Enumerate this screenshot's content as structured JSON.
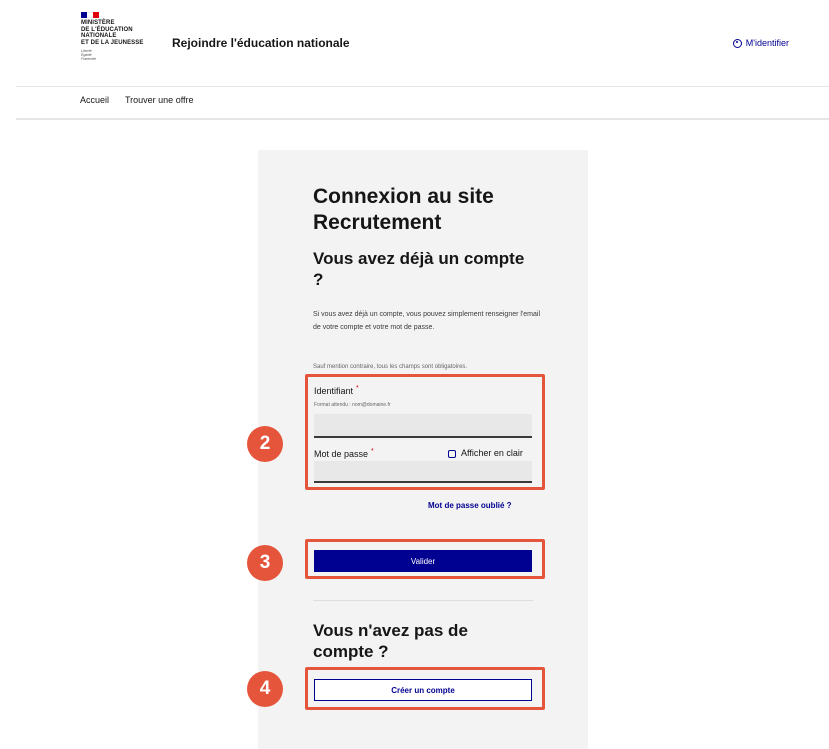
{
  "header": {
    "logo_lines": [
      "MINISTÈRE",
      "DE L'ÉDUCATION",
      "NATIONALE",
      "ET DE LA JEUNESSE"
    ],
    "devise": [
      "Liberté",
      "Égalité",
      "Fraternité"
    ],
    "flag_colors": [
      "#000091",
      "#ffffff",
      "#e1000f"
    ],
    "site_title": "Rejoindre l'éducation nationale",
    "login_link": "M'identifier",
    "login_icon": "user-icon"
  },
  "nav": {
    "items": [
      "Accueil",
      "Trouver une offre"
    ]
  },
  "login": {
    "title": "Connexion au site Recrutement",
    "subtitle": "Vous avez déjà un compte ?",
    "intro": "Si vous avez déjà un compte, vous pouvez simplement renseigner l'email de votre compte et votre mot de passe.",
    "mention": "Sauf mention contraire, tous les champs sont obligatoires.",
    "identifiant_label": "Identifiant",
    "identifiant_hint": "Format attendu : nom@domaine.fr",
    "identifiant_value": "",
    "password_label": "Mot de passe",
    "password_value": "",
    "required_mark": "*",
    "show_password_label": "Afficher en clair",
    "forgot_password": "Mot de passe oublié ?",
    "submit_button": "Valider"
  },
  "signup": {
    "title": "Vous n'avez pas de compte ?",
    "create_button": "Créer un compte"
  },
  "badges": [
    "2",
    "3",
    "4"
  ],
  "colors": {
    "primary": "#000091",
    "highlight": "#e4553b",
    "required": "#ce0500",
    "card_bg": "#f3f3f3"
  }
}
